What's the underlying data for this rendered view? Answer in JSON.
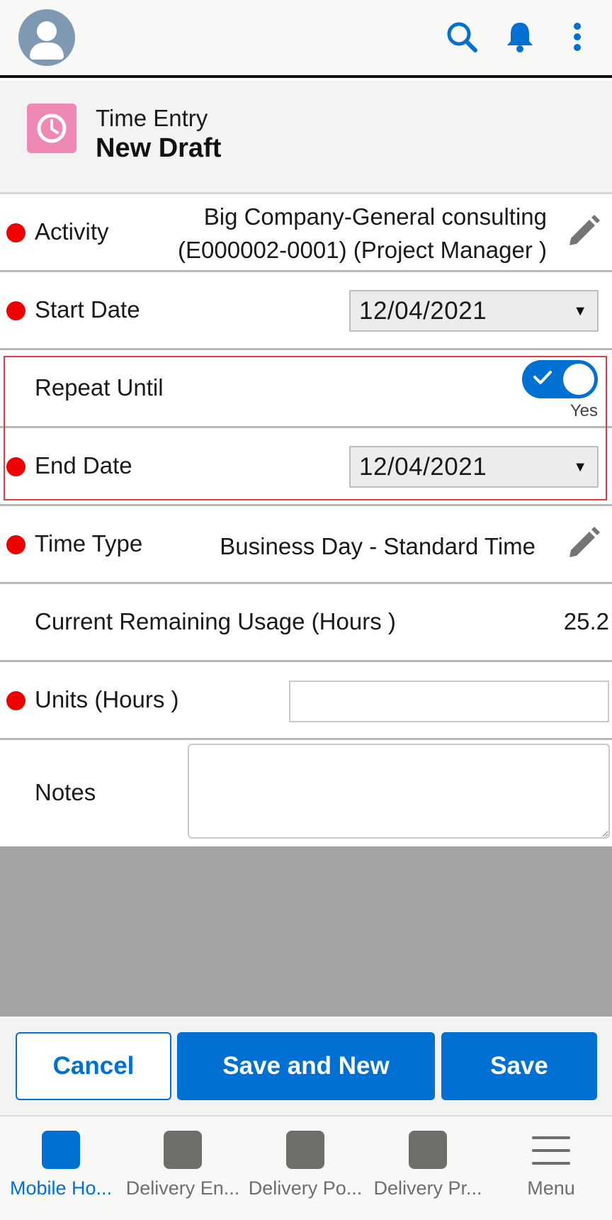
{
  "header": {
    "record_type": "Time Entry",
    "record_title": "New Draft"
  },
  "form": {
    "activity": {
      "label": "Activity",
      "value_line1": "Big Company-General consulting",
      "value_line2": "(E000002-0001) (Project Manager )"
    },
    "start_date": {
      "label": "Start Date",
      "value": "12/04/2021"
    },
    "repeat_until": {
      "label": "Repeat Until",
      "toggle_state": "Yes"
    },
    "end_date": {
      "label": "End Date",
      "value": "12/04/2021"
    },
    "time_type": {
      "label": "Time Type",
      "value": "Business Day - Standard Time"
    },
    "remaining_usage": {
      "label": "Current Remaining Usage (Hours )",
      "value": "25.2"
    },
    "units": {
      "label": "Units (Hours )",
      "value": ""
    },
    "notes": {
      "label": "Notes",
      "value": ""
    }
  },
  "actions": {
    "cancel": "Cancel",
    "save_and_new": "Save and New",
    "save": "Save"
  },
  "tabs": [
    {
      "label": "Mobile Ho...",
      "active": true
    },
    {
      "label": "Delivery En...",
      "active": false
    },
    {
      "label": "Delivery Po...",
      "active": false
    },
    {
      "label": "Delivery Pr...",
      "active": false
    },
    {
      "label": "Menu",
      "active": false
    }
  ],
  "colors": {
    "brand_blue": "#0070d2",
    "required_red": "#ee0000",
    "record_icon_pink": "#f088b6",
    "highlight_red": "#e53a40"
  },
  "icons": {
    "top": [
      "avatar",
      "search-icon",
      "bell-icon",
      "more-vertical-icon"
    ],
    "record": "clock-icon",
    "edit": "pencil-icon"
  }
}
